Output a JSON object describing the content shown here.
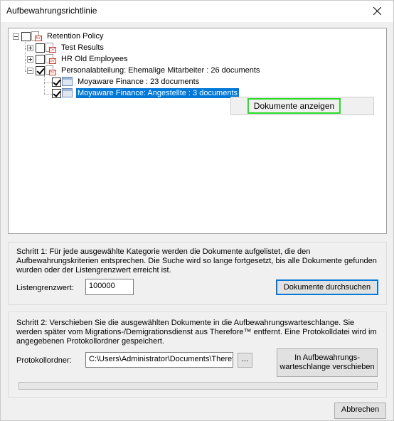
{
  "window": {
    "title": "Aufbewahrungsrichtlinie"
  },
  "tree": {
    "root": "Retention Policy",
    "nodes": [
      {
        "label": "Test Results"
      },
      {
        "label": "HR Old Employees"
      },
      {
        "label": "Personalabteilung: Ehemalige Mitarbeiter : 26 documents"
      },
      {
        "label": "Moyaware Finance : 23 documents"
      },
      {
        "label": "Moyaware Finance: Angestellte : 3 documents"
      }
    ]
  },
  "context_menu": {
    "item": "Dokumente anzeigen"
  },
  "step1": {
    "description": "Schritt 1: Für jede ausgewählte Kategorie werden die Dokumente aufgelistet, die den Aufbewahrungskriterien entsprechen. Die Suche wird so lange fortgesetzt, bis alle Dokumente gefunden wurden oder der Listengrenzwert erreicht ist.",
    "limit_label": "Listengrenzwert:",
    "limit_value": "100000",
    "search_button": "Dokumente durchsuchen"
  },
  "step2": {
    "description": "Schritt 2: Verschieben Sie die ausgewählten Dokumente in die Aufbewahrungswarteschlange. Sie werden später vom Migrations-/Demigrationsdienst aus Therefore™ entfernt. Eine Protokolldatei wird im angegebenen Protokollordner gespeichert.",
    "folder_label": "Protokollordner:",
    "folder_value": "C:\\Users\\Administrator\\Documents\\Therefore",
    "browse_button": "...",
    "move_button_line1": "In Aufbewahrungs-",
    "move_button_line2": "warteschlange verschieben"
  },
  "footer": {
    "cancel_button": "Abbrechen"
  }
}
